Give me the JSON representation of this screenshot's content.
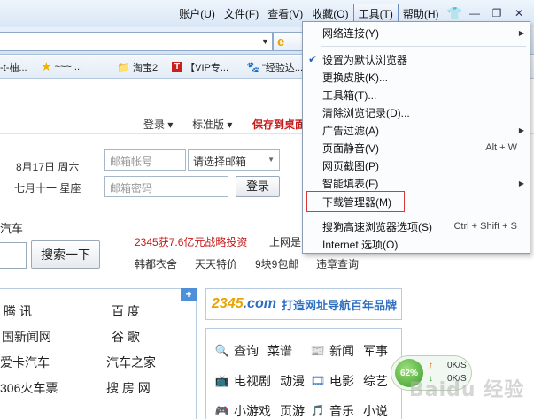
{
  "menubar": {
    "items": [
      {
        "label": "账户(U)",
        "name": "menu-account"
      },
      {
        "label": "文件(F)",
        "name": "menu-file"
      },
      {
        "label": "查看(V)",
        "name": "menu-view"
      },
      {
        "label": "收藏(O)",
        "name": "menu-favorites"
      },
      {
        "label": "工具(T)",
        "name": "menu-tools"
      },
      {
        "label": "帮助(H)",
        "name": "menu-help"
      }
    ]
  },
  "favorites": {
    "items": [
      {
        "label": "-t-柚...",
        "icon": "page-icon"
      },
      {
        "label": "~~~ ...",
        "icon": "star-icon"
      },
      {
        "label": "淘宝2",
        "icon": "folder-icon"
      },
      {
        "label": "【VIP专...",
        "icon": "t-brand-icon"
      },
      {
        "label": "\"经验达...",
        "icon": "paw-icon"
      }
    ]
  },
  "page": {
    "login": "登录",
    "standard": "标准版",
    "save_to_desktop": "保存到桌面",
    "date_line1": "8月17日 周六",
    "date_line2": "七月十一 星座",
    "email_placeholder": "邮箱帐号",
    "email_select": "请选择邮箱",
    "password_placeholder": "邮箱密码",
    "login_button": "登录",
    "car_label": "汽车",
    "search_button": "搜索一下",
    "ad_text": "2345获7.6亿元战略投资",
    "internet_label": "上网是",
    "quick_links": [
      "韩都衣舍",
      "天天特价",
      "9块9包邮",
      "违章查询"
    ],
    "plus_label": "+"
  },
  "left_nav": {
    "rows": [
      [
        "腾 讯",
        "百 度"
      ],
      [
        "国新闻网",
        "谷 歌"
      ],
      [
        "爱卡汽车",
        "汽车之家"
      ],
      [
        "306火车票",
        "搜 房 网"
      ]
    ]
  },
  "banner": {
    "logo_main": "2345",
    "logo_suffix": ".com",
    "text": "打造网址导航百年品牌"
  },
  "categories": [
    {
      "left": "查询",
      "right": "菜谱",
      "icon": "search-icon"
    },
    {
      "left": "新闻",
      "right": "军事",
      "icon": "news-icon"
    },
    {
      "left": "电视剧",
      "right": "动漫",
      "icon": "tv-icon"
    },
    {
      "left": "电影",
      "right": "综艺",
      "icon": "film-icon"
    },
    {
      "left": "小游戏",
      "right": "页游",
      "icon": "game-icon"
    },
    {
      "left": "音乐",
      "right": "小说",
      "icon": "music-icon"
    }
  ],
  "dropdown": {
    "items": [
      {
        "label": "网络连接(Y)",
        "shortcut": "",
        "arrow": true,
        "checked": false
      },
      {
        "label": "设置为默认浏览器",
        "shortcut": "",
        "arrow": false,
        "checked": true
      },
      {
        "label": "更换皮肤(K)...",
        "shortcut": "",
        "arrow": false,
        "checked": false
      },
      {
        "label": "工具箱(T)...",
        "shortcut": "",
        "arrow": false,
        "checked": false
      },
      {
        "label": "清除浏览记录(D)...",
        "shortcut": "",
        "arrow": false,
        "checked": false
      },
      {
        "label": "广告过滤(A)",
        "shortcut": "",
        "arrow": true,
        "checked": false
      },
      {
        "label": "页面静音(V)",
        "shortcut": "Alt + W",
        "arrow": false,
        "checked": false
      },
      {
        "label": "网页截图(P)",
        "shortcut": "",
        "arrow": false,
        "checked": false
      },
      {
        "label": "智能填表(F)",
        "shortcut": "",
        "arrow": true,
        "checked": false
      },
      {
        "label": "下载管理器(M)",
        "shortcut": "",
        "arrow": false,
        "checked": false,
        "highlighted": true
      },
      {
        "label": "搜狗高速浏览器选项(S)",
        "shortcut": "Ctrl + Shift + S",
        "arrow": false,
        "checked": false
      },
      {
        "label": "Internet 选项(O)",
        "shortcut": "",
        "arrow": false,
        "checked": false
      }
    ]
  },
  "speed": {
    "percent": "62%",
    "up": "0K/S",
    "down": "0K/S"
  },
  "watermark": "Baidu 经验",
  "colors": {
    "accent": "#2f6fc1",
    "red": "#c51a1a",
    "highlight_box": "#d8383a"
  }
}
